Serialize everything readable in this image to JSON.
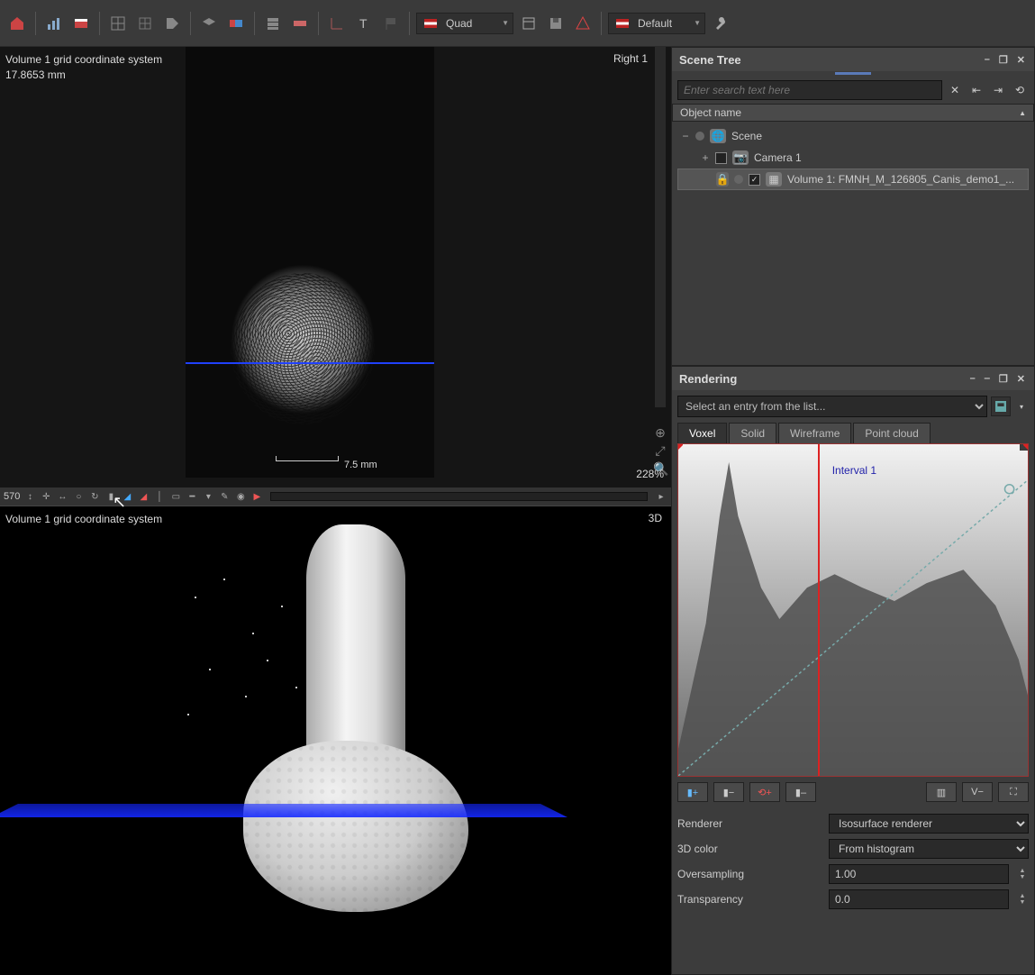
{
  "toolbar": {
    "layout_label": "Quad",
    "preset_label": "Default"
  },
  "viewport_top": {
    "label_tl_line1": "Volume 1 grid coordinate system",
    "label_tl_line2": "17.8653 mm",
    "label_tr": "Right 1",
    "zoom": "228%",
    "scalebar": "7.5 mm",
    "bottombar_value": "570"
  },
  "viewport_bottom": {
    "label_tl": "Volume 1 grid coordinate system",
    "label_tr": "3D"
  },
  "scene_tree": {
    "title": "Scene Tree",
    "search_placeholder": "Enter search text here",
    "header": "Object name",
    "nodes": {
      "scene": "Scene",
      "camera": "Camera 1",
      "volume": "Volume 1: FMNH_M_126805_Canis_demo1_..."
    }
  },
  "rendering": {
    "title": "Rendering",
    "select_placeholder": "Select an entry from the list...",
    "tabs": {
      "voxel": "Voxel",
      "solid": "Solid",
      "wireframe": "Wireframe",
      "pointcloud": "Point cloud"
    },
    "interval_label": "Interval 1",
    "toolbar": {
      "vminus": "V−"
    },
    "props": {
      "renderer_label": "Renderer",
      "renderer_value": "Isosurface renderer",
      "color_label": "3D color",
      "color_value": "From histogram",
      "oversampling_label": "Oversampling",
      "oversampling_value": "1.00",
      "transparency_label": "Transparency",
      "transparency_value": "0.0"
    }
  }
}
